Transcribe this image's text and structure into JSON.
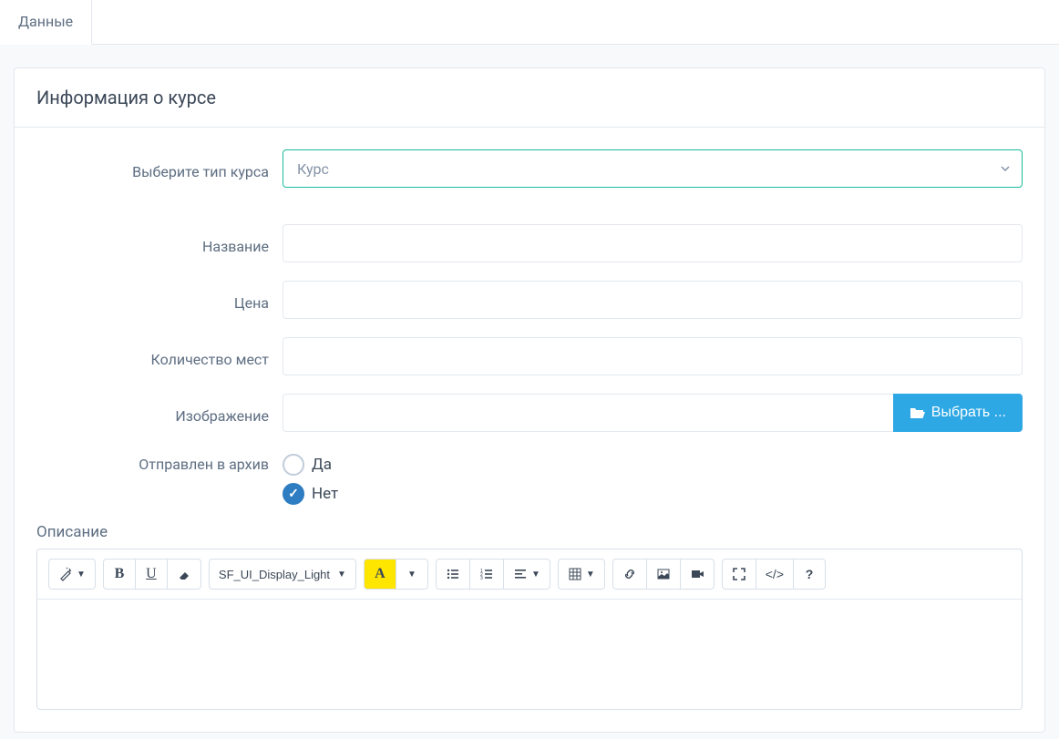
{
  "tabs": [
    {
      "label": "Данные",
      "active": true
    }
  ],
  "panel": {
    "title": "Информация о курсе"
  },
  "form": {
    "type_label": "Выберите тип курса",
    "type_value": "Курс",
    "name_label": "Название",
    "name_value": "",
    "price_label": "Цена",
    "price_value": "",
    "seats_label": "Количество мест",
    "seats_value": "",
    "image_label": "Изображение",
    "image_value": "",
    "browse_label": "Выбрать ...",
    "archived_label": "Отправлен в архив",
    "archived_options": {
      "yes": "Да",
      "no": "Нет"
    },
    "archived_value": "no"
  },
  "description": {
    "label": "Описание",
    "font_name": "SF_UI_Display_Light",
    "content": ""
  }
}
